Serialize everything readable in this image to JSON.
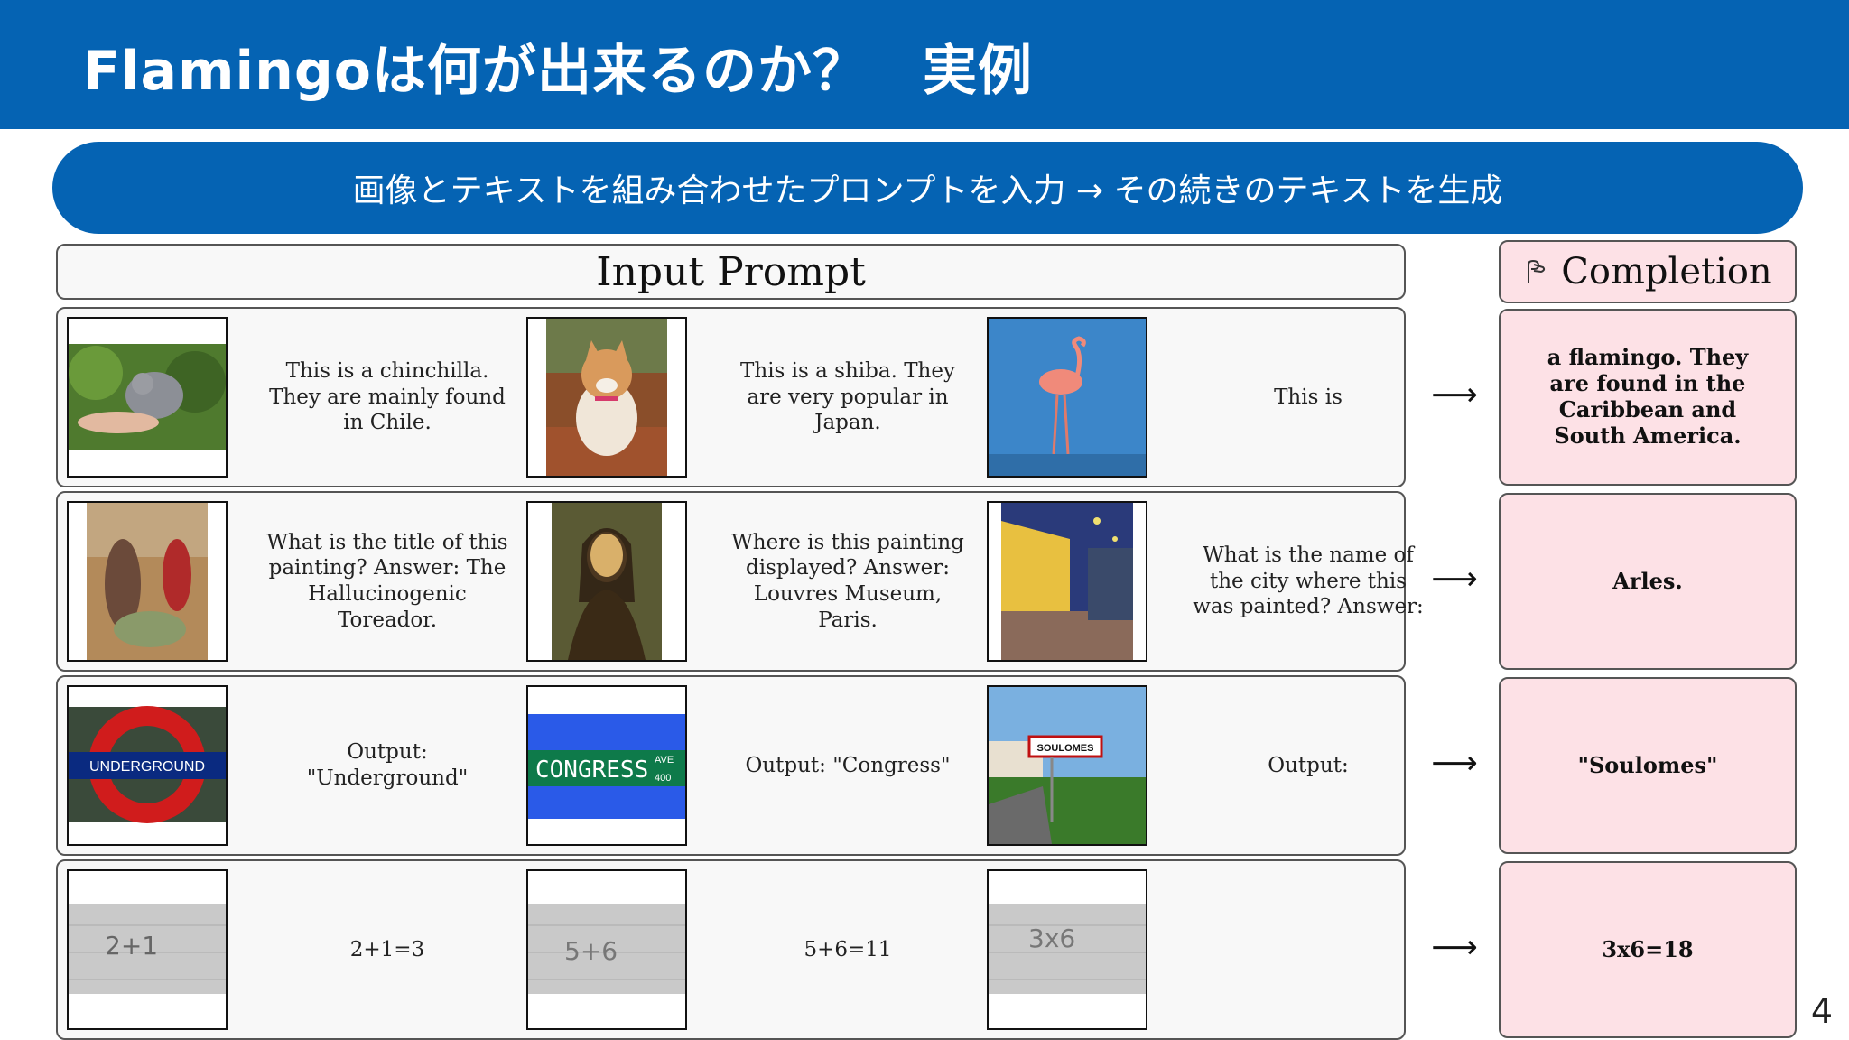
{
  "header": {
    "title": "Flamingoは何が出来るのか？　実例"
  },
  "banner": {
    "text": "画像とテキストを組み合わせたプロンプトを入力 → その続きのテキストを生成"
  },
  "input_prompt_label": "Input Prompt",
  "completion_label": "Completion",
  "arrow_symbol": "⟶",
  "rows": [
    {
      "texts": [
        "This is a chinchilla. They are mainly found in Chile.",
        "This is a shiba. They are very popular in Japan.",
        "This is"
      ],
      "completion": "a flamingo. They are found in the Caribbean and South America."
    },
    {
      "texts": [
        "What is the title of this painting? Answer: The Hallucinogenic Toreador.",
        "Where is this painting displayed? Answer: Louvres Museum, Paris.",
        "What is the name of the city where this was painted? Answer:"
      ],
      "completion": "Arles."
    },
    {
      "texts": [
        "Output: \"Underground\"",
        "Output: \"Congress\"",
        "Output:"
      ],
      "completion": "\"Soulomes\""
    },
    {
      "texts": [
        "2+1=3",
        "5+6=11",
        ""
      ],
      "completion": "3x6=18"
    }
  ],
  "images": {
    "underground_sign": "UNDERGROUND",
    "congress_sign": "CONGRESS",
    "congress_ave": "AVE",
    "congress_num": "400",
    "soulomes_sign": "SOULOMES",
    "hw1": "2+1",
    "hw2": "5+6",
    "hw3": "3x6"
  },
  "page_number": "4"
}
